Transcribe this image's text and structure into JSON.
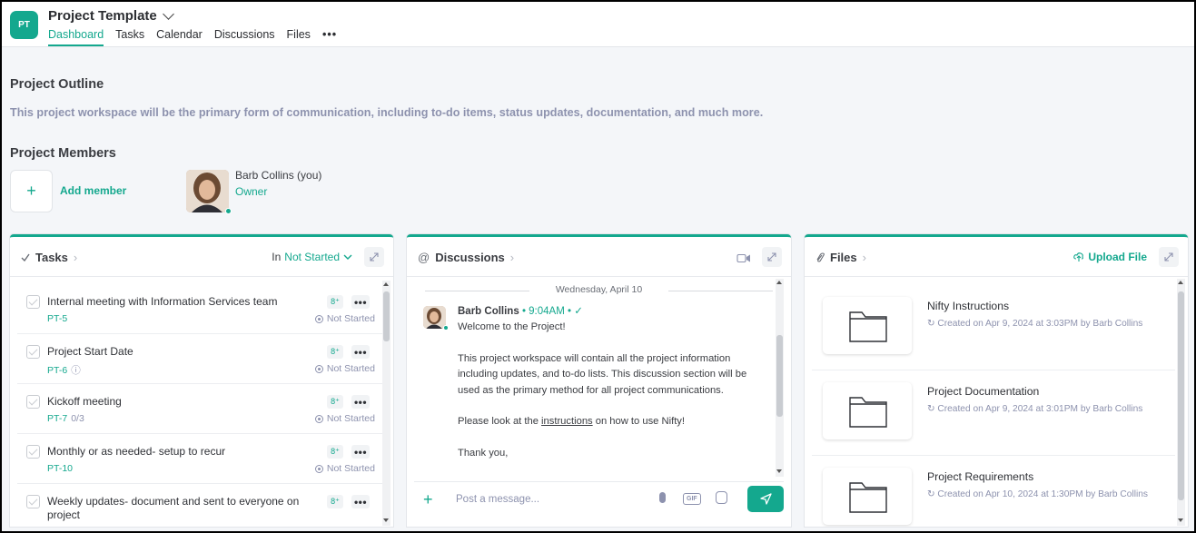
{
  "header": {
    "avatar_initials": "PT",
    "project_title": "Project Template",
    "tabs": [
      {
        "label": "Dashboard",
        "active": true
      },
      {
        "label": "Tasks",
        "active": false
      },
      {
        "label": "Calendar",
        "active": false
      },
      {
        "label": "Discussions",
        "active": false
      },
      {
        "label": "Files",
        "active": false
      },
      {
        "label": "•••",
        "active": false
      }
    ]
  },
  "outline": {
    "title": "Project Outline",
    "description": "This project workspace will be the primary form of communication, including to-do items, status updates, documentation, and much more."
  },
  "members": {
    "title": "Project Members",
    "add_icon": "+",
    "add_label": "Add member",
    "list": [
      {
        "name": "Barb Collins (you)",
        "role": "Owner"
      }
    ]
  },
  "tasks_panel": {
    "title": "Tasks",
    "filter_prefix": "In",
    "filter_value": "Not Started",
    "rows": [
      {
        "name": "Internal meeting with Information Services team",
        "id": "PT-5",
        "meta": "",
        "status": "Not Started"
      },
      {
        "name": "Project Start Date",
        "id": "PT-6",
        "meta": "ⓘ",
        "status": "Not Started"
      },
      {
        "name": "Kickoff meeting",
        "id": "PT-7",
        "meta": "0/3",
        "status": "Not Started"
      },
      {
        "name": "Monthly or as needed- setup to recur",
        "id": "PT-10",
        "meta": "",
        "status": "Not Started"
      },
      {
        "name": "Weekly updates- document and sent to everyone on project",
        "id": "",
        "meta": "",
        "status": ""
      }
    ]
  },
  "discussions_panel": {
    "title": "Discussions",
    "date_separator": "Wednesday, April 10",
    "message": {
      "author": "Barb Collins",
      "time": "• 9:04AM • ✓",
      "para1": "Welcome to the Project!",
      "para2": "This project workspace will contain all the project information including updates, and to-do lists. This discussion section will be used as the primary method for all project communications.",
      "para3_before": "Please look at the ",
      "para3_link": "instructions",
      "para3_after": " on how to use Nifty!",
      "para4": "Thank you,"
    },
    "composer": {
      "placeholder": "Post a message...",
      "gif_label": "GIF",
      "plus_icon": "+"
    }
  },
  "files_panel": {
    "title": "Files",
    "upload_label": "Upload File",
    "files": [
      {
        "name": "Nifty Instructions",
        "meta": "Created on Apr 9, 2024 at 3:03PM by Barb Collins"
      },
      {
        "name": "Project Documentation",
        "meta": "Created on Apr 9, 2024 at 3:01PM by Barb Collins"
      },
      {
        "name": "Project Requirements",
        "meta": "Created on Apr 10, 2024 at 1:30PM by Barb Collins"
      }
    ]
  },
  "colors": {
    "accent": "#14a88e",
    "muted": "#8d92ae",
    "background": "#f4f6f9"
  },
  "icons": [
    "chevron-down-icon",
    "check-icon",
    "chevron-right-icon",
    "expand-icon",
    "at-icon",
    "video-icon",
    "paperclip-icon",
    "upload-icon",
    "folder-icon",
    "plus-icon",
    "mic-icon",
    "gif-icon",
    "sticker-icon",
    "send-icon",
    "more-icon",
    "assign-user-icon",
    "status-icon",
    "refresh-icon"
  ]
}
